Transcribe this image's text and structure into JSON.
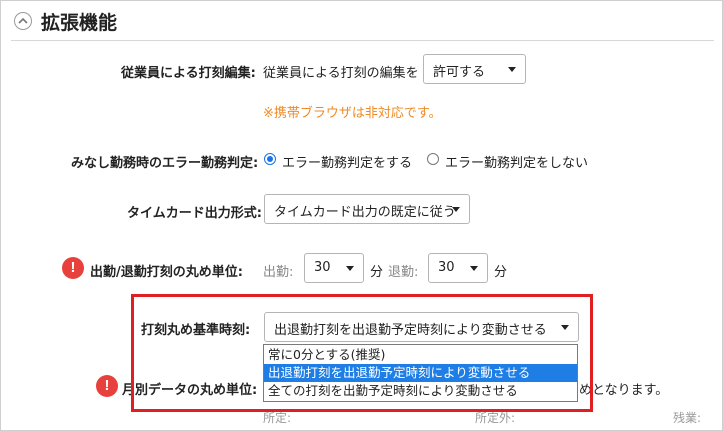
{
  "section": {
    "title": "拡張機能"
  },
  "employee_edit": {
    "label": "従業員による打刻編集:",
    "prefix": "従業員による打刻の編集を",
    "select_value": "許可する",
    "notice": "※携帯ブラウザは非対応です。"
  },
  "error_judgment": {
    "label": "みなし勤務時のエラー勤務判定:",
    "option_on": "エラー勤務判定をする",
    "option_off": "エラー勤務判定をしない",
    "selected": "option_on"
  },
  "timecard_format": {
    "label": "タイムカード出力形式:",
    "select_value": "タイムカード出力の既定に従う"
  },
  "rounding_unit": {
    "label": "出勤/退勤打刻の丸め単位:",
    "in_label": "出勤:",
    "in_value": "30",
    "in_unit": "分",
    "out_label": "退勤:",
    "out_value": "30",
    "out_unit": "分"
  },
  "rounding_base": {
    "label": "打刻丸め基準時刻:",
    "select_value": "出退勤打刻を出退勤予定時刻により変動させる",
    "options": [
      "常に0分とする(推奨)",
      "出退勤打刻を出退勤予定時刻により変動させる",
      "全ての打刻を出勤予定時刻により変動させる"
    ],
    "highlighted_index": 1
  },
  "monthly_rounding": {
    "label": "月別データの丸め単位:",
    "trailing_text": "めとなります。",
    "sub_label_1": "所定:",
    "sub_label_2": "所定外:",
    "sub_label_3": "残業:"
  },
  "colors": {
    "accent": "#1e7ee6",
    "warning_text": "#f08a24",
    "alert_icon": "#e8413d",
    "highlight_box": "#e02020"
  }
}
